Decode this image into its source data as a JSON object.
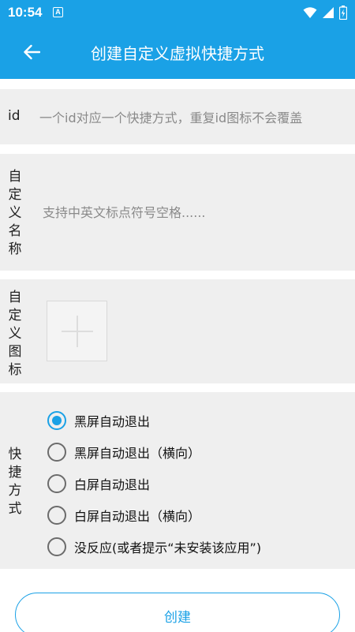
{
  "status_bar": {
    "time": "10:54",
    "notification_icon_letter": "A",
    "icons": [
      "wifi-icon",
      "cell-signal-icon",
      "battery-icon"
    ]
  },
  "app_bar": {
    "title": "创建自定义虚拟快捷方式",
    "back_icon": "arrow-left-icon"
  },
  "form": {
    "id": {
      "label": "id",
      "placeholder": "一个id对应一个快捷方式，重复id图标不会覆盖",
      "value": ""
    },
    "name": {
      "label_chars": [
        "自",
        "定",
        "义",
        "名",
        "称"
      ],
      "placeholder": "支持中英文标点符号空格......",
      "value": ""
    },
    "icon": {
      "label_chars": [
        "自",
        "定",
        "义",
        "图",
        "标"
      ],
      "add_icon": "plus-icon"
    },
    "mode": {
      "label_chars": [
        "快",
        "捷",
        "方",
        "式"
      ],
      "options": [
        {
          "label": "黑屏自动退出",
          "checked": true
        },
        {
          "label": "黑屏自动退出（横向）",
          "checked": false
        },
        {
          "label": "白屏自动退出",
          "checked": false
        },
        {
          "label": "白屏自动退出（横向）",
          "checked": false
        },
        {
          "label": "没反应(或者提示“未安装该应用”)",
          "checked": false
        }
      ]
    }
  },
  "create_button": {
    "label": "创建"
  },
  "colors": {
    "accent": "#1aa1e6",
    "card_bg": "#efefef"
  }
}
